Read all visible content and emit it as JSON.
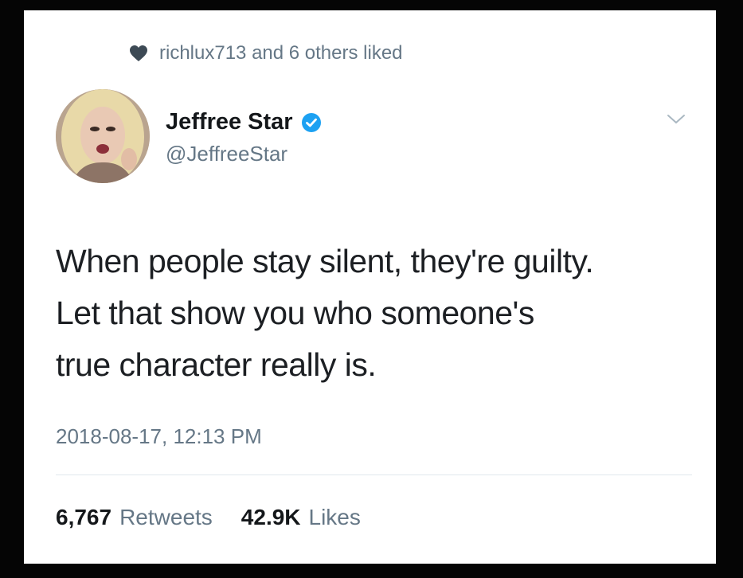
{
  "liked_by": {
    "text": "richlux713 and 6 others liked"
  },
  "author": {
    "display_name": "Jeffree Star",
    "handle": "@JeffreeStar",
    "verified": true
  },
  "tweet": {
    "lines": [
      "When people stay silent, they're guilty.",
      "Let that show you who someone's",
      "true character really is."
    ],
    "timestamp": "2018-08-17, 12:13 PM"
  },
  "stats": {
    "retweets_count": "6,767",
    "retweets_label": "Retweets",
    "likes_count": "42.9K",
    "likes_label": "Likes"
  },
  "colors": {
    "verified_blue": "#1da1f2",
    "secondary_text": "#657786",
    "primary_text": "#14171a"
  },
  "icons": {
    "liked": "heart-icon",
    "verified": "verified-badge-icon",
    "menu": "chevron-down-icon"
  }
}
